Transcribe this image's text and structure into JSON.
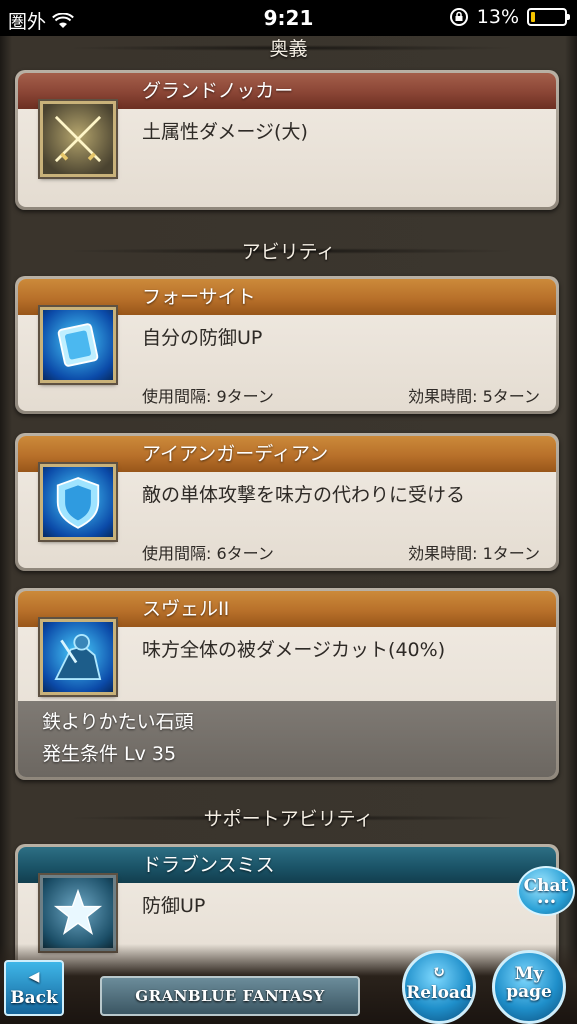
{
  "status_bar": {
    "carrier": "圏外",
    "time": "9:21",
    "battery": "13%",
    "battery_level": 0.13
  },
  "sections": {
    "ougi": "奥義",
    "abilities": "アビリティ",
    "support": "サポートアビリティ"
  },
  "ougi_card": {
    "name": "グランドノッカー",
    "description": "土属性ダメージ(大)",
    "icon": "crossed-swords-icon"
  },
  "ability_cards": [
    {
      "name": "フォーサイト",
      "description": "自分の防御UP",
      "cooldown": "使用間隔: 9ターン",
      "duration": "効果時間: 5ターン",
      "icon": "shield-blue-icon"
    },
    {
      "name": "アイアンガーディアン",
      "description": "敵の単体攻撃を味方の代わりに受ける",
      "cooldown": "使用間隔: 6ターン",
      "duration": "効果時間: 1ターン",
      "icon": "shield-crest-icon"
    },
    {
      "name": "スヴェルII",
      "description": "味方全体の被ダメージカット(40%)",
      "locked_name": "鉄よりかたい石頭",
      "unlock_condition": "発生条件 Lv 35",
      "icon": "knight-icon"
    }
  ],
  "support_card": {
    "name": "ドラブンスミス",
    "description": "防御UP",
    "icon": "star-icon"
  },
  "controls": {
    "chat": "Chat",
    "chat_dots": "•••",
    "back": "Back",
    "reload": "Reload",
    "mypage_line1": "My",
    "mypage_line2": "page",
    "logo": "GRANBLUE FANTASY"
  }
}
